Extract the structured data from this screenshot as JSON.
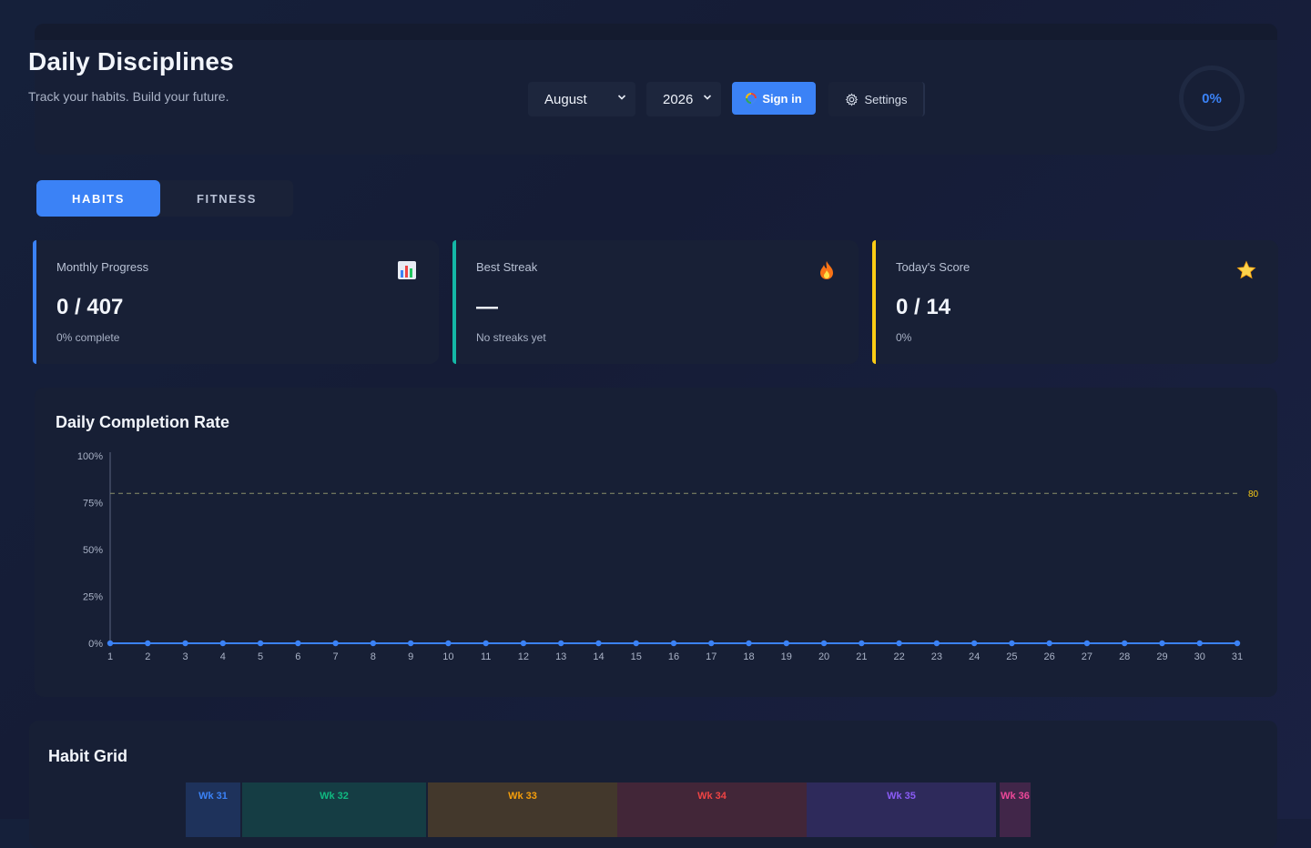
{
  "header": {
    "title": "Daily Disciplines",
    "subtitle": "Track your habits. Build your future.",
    "month": "August",
    "year": "2026",
    "signin_label": "Sign in",
    "settings_label": "Settings",
    "overall_percent": "0%"
  },
  "tabs": [
    {
      "label": "HABITS",
      "active": true
    },
    {
      "label": "FITNESS",
      "active": false
    }
  ],
  "stats": [
    {
      "label": "Monthly Progress",
      "value": "0 / 407",
      "sub": "0% complete",
      "accent": "#3b82f6",
      "icon": "bar-chart-icon"
    },
    {
      "label": "Best Streak",
      "value": "—",
      "sub": "No streaks yet",
      "accent": "#14b8a6",
      "icon": "fire-icon"
    },
    {
      "label": "Today's Score",
      "value": "0 / 14",
      "sub": "0%",
      "accent": "#facc15",
      "icon": "star-icon"
    }
  ],
  "chart_data": {
    "type": "line",
    "title": "Daily Completion Rate",
    "x": [
      1,
      2,
      3,
      4,
      5,
      6,
      7,
      8,
      9,
      10,
      11,
      12,
      13,
      14,
      15,
      16,
      17,
      18,
      19,
      20,
      21,
      22,
      23,
      24,
      25,
      26,
      27,
      28,
      29,
      30,
      31
    ],
    "values": [
      0,
      0,
      0,
      0,
      0,
      0,
      0,
      0,
      0,
      0,
      0,
      0,
      0,
      0,
      0,
      0,
      0,
      0,
      0,
      0,
      0,
      0,
      0,
      0,
      0,
      0,
      0,
      0,
      0,
      0,
      0
    ],
    "ylim": [
      0,
      100
    ],
    "yticks": [
      "0%",
      "25%",
      "50%",
      "75%",
      "100%"
    ],
    "target_line": {
      "value": 80,
      "label": "80",
      "color": "#facc15"
    },
    "line_color": "#3b82f6",
    "grid": false
  },
  "habit_grid": {
    "title": "Habit Grid",
    "weeks": [
      {
        "label": "Wk 31",
        "color": "#3b82f6"
      },
      {
        "label": "Wk 32",
        "color": "#10b981"
      },
      {
        "label": "Wk 33",
        "color": "#f59e0b"
      },
      {
        "label": "Wk 34",
        "color": "#ef4444"
      },
      {
        "label": "Wk 35",
        "color": "#8b5cf6"
      },
      {
        "label": "Wk 36",
        "color": "#ec4899"
      }
    ]
  }
}
